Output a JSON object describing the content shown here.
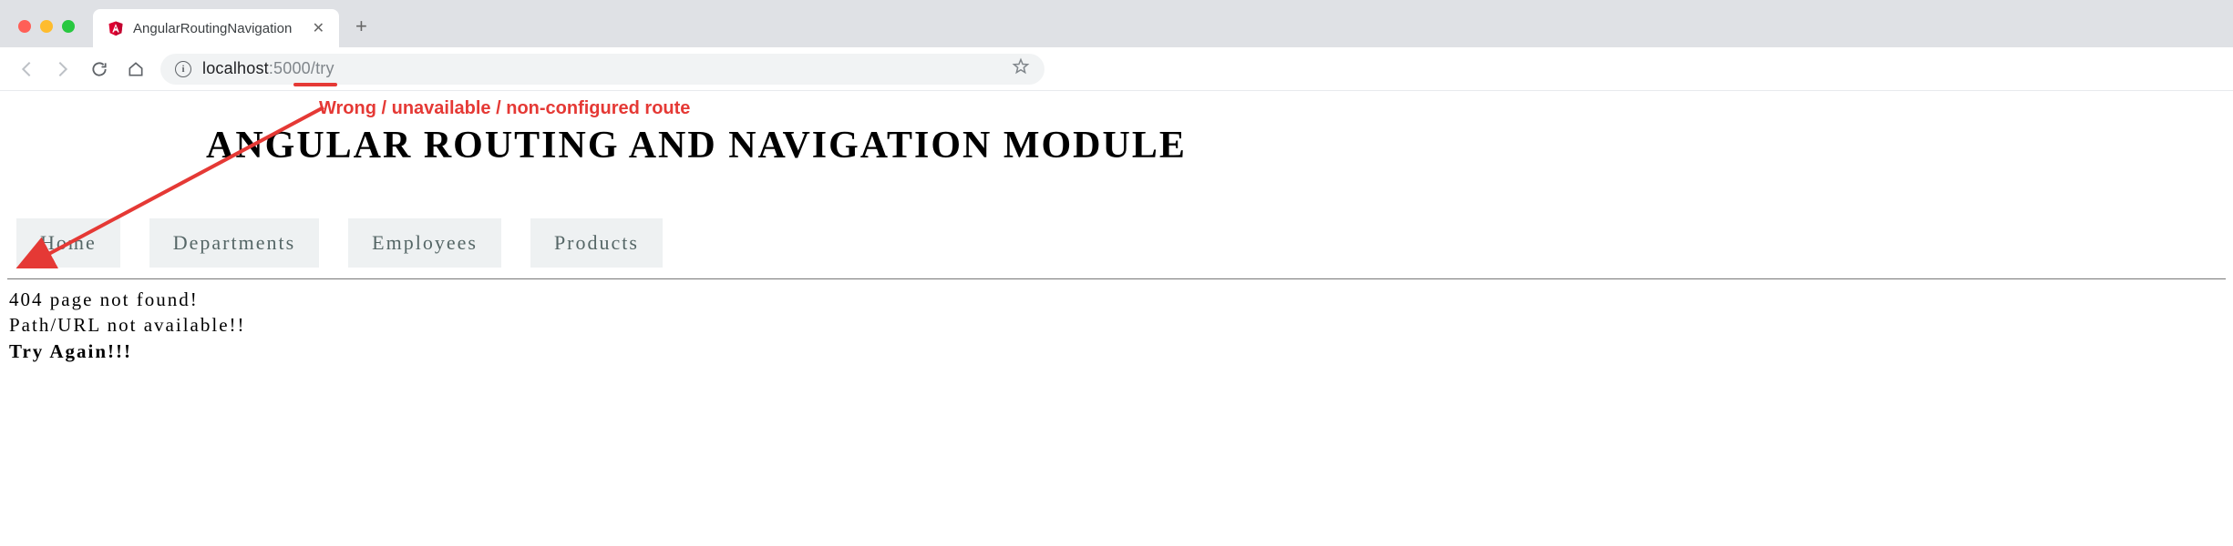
{
  "browser": {
    "tab_title": "AngularRoutingNavigation",
    "url_host": "localhost",
    "url_path": ":5000/try",
    "annotation": "Wrong / unavailable / non-configured route"
  },
  "page": {
    "title": "ANGULAR ROUTING AND NAVIGATION MODULE",
    "nav": {
      "home": "Home",
      "departments": "Departments",
      "employees": "Employees",
      "products": "Products"
    },
    "error": {
      "line1": "404 page not found!",
      "line2": "Path/URL not available!!",
      "line3": "Try Again!!!"
    }
  }
}
